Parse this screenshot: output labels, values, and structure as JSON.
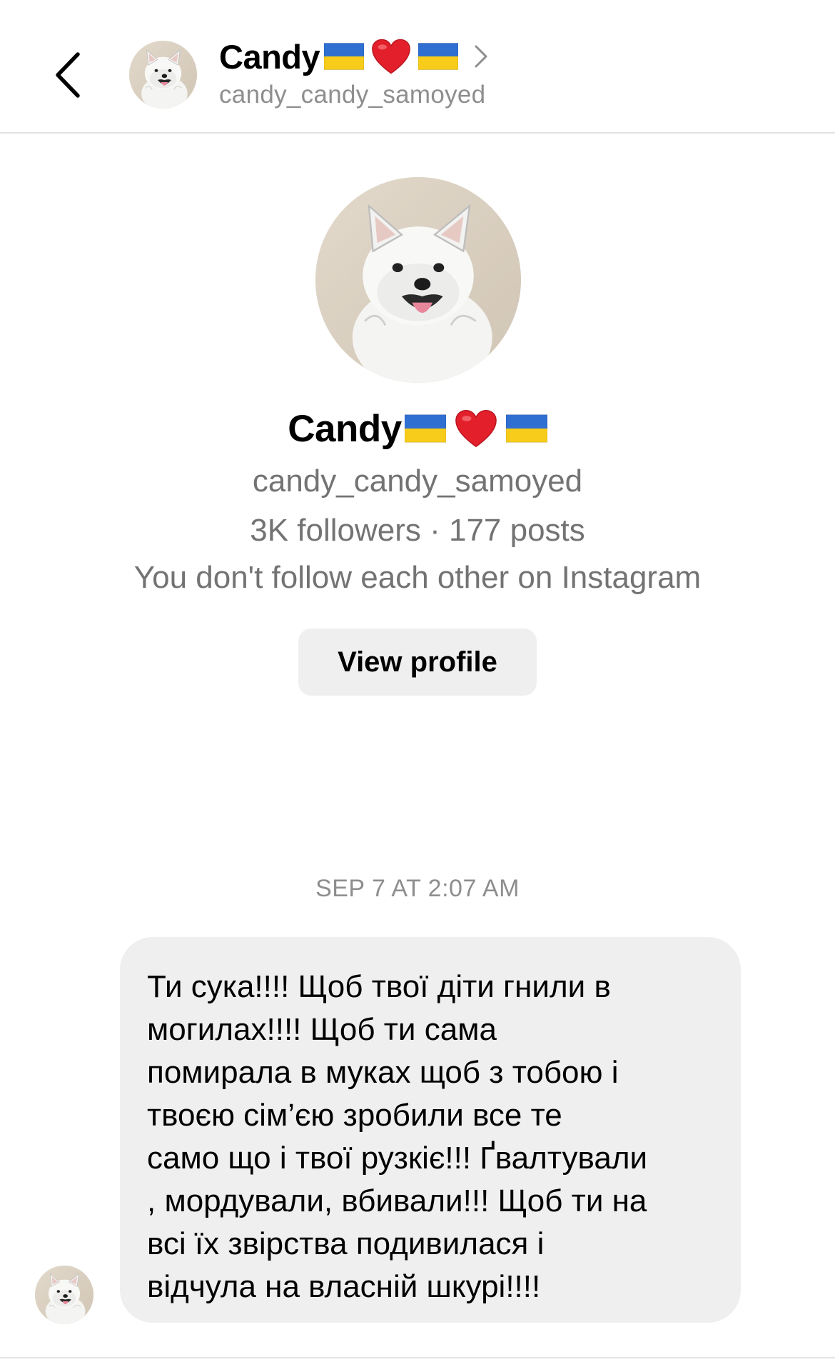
{
  "header": {
    "back_icon": "chevron-left-icon",
    "display_name": "Candy",
    "username": "candy_candy_samoyed",
    "chevron_icon": "chevron-right-icon",
    "name_emojis": [
      "ukraine-flag-emoji",
      "red-heart-emoji",
      "ukraine-flag-emoji"
    ]
  },
  "profile": {
    "display_name": "Candy",
    "username": "candy_candy_samoyed",
    "stats": "3K followers · 177 posts",
    "follow_status": "You don't follow each other on Instagram",
    "view_profile_label": "View profile"
  },
  "thread": {
    "timestamp": "SEP 7 AT 2:07 AM",
    "messages": [
      {
        "sender": "candy_candy_samoyed",
        "text": "Ти сука!!!! Щоб твої діти гнили в\nмогилах!!!! Щоб ти сама\nпомирала в муках щоб з тобою і\nтвоєю сім’єю зробили все те\nсамо що і твої рузкіє!!! Ґвалтували\n, мордували, вбивали!!! Щоб ти на\nвсі їх звірства подивилася і\nвідчула на власній шкурі!!!!"
      }
    ]
  },
  "colors": {
    "secondary_text": "#737373",
    "muted_text": "#8e8e8e",
    "bubble_bg": "#efefef",
    "button_bg": "#efefef",
    "divider": "#e3e3e3"
  }
}
